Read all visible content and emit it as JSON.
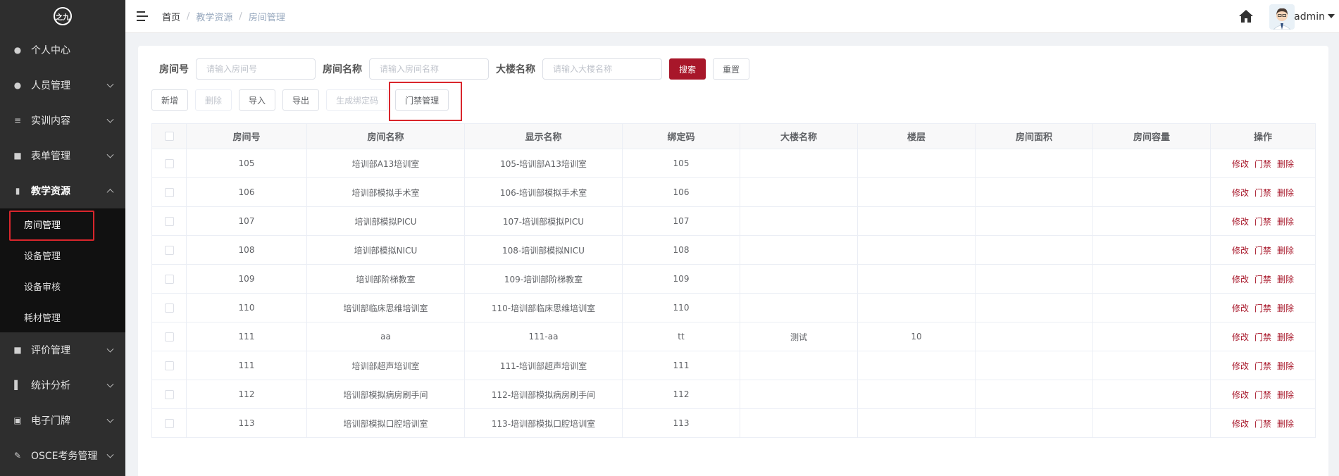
{
  "sidebar": {
    "logo": "之九",
    "items": [
      {
        "label": "个人中心",
        "icon": "user-icon",
        "expandable": false
      },
      {
        "label": "人员管理",
        "icon": "users-icon",
        "expandable": true
      },
      {
        "label": "实训内容",
        "icon": "list-icon",
        "expandable": true
      },
      {
        "label": "表单管理",
        "icon": "form-icon",
        "expandable": true
      },
      {
        "label": "教学资源",
        "icon": "book-icon",
        "expandable": true,
        "expanded": true,
        "children": [
          {
            "label": "房间管理",
            "current": true
          },
          {
            "label": "设备管理"
          },
          {
            "label": "设备审核"
          },
          {
            "label": "耗材管理"
          }
        ]
      },
      {
        "label": "评价管理",
        "icon": "rating-icon",
        "expandable": true
      },
      {
        "label": "统计分析",
        "icon": "bar-chart-icon",
        "expandable": true
      },
      {
        "label": "电子门牌",
        "icon": "monitor-icon",
        "expandable": true
      },
      {
        "label": "OSCE考务管理",
        "icon": "edit-icon",
        "expandable": true
      }
    ]
  },
  "header": {
    "breadcrumb": [
      "首页",
      "教学资源",
      "房间管理"
    ],
    "user": "admin"
  },
  "filters": {
    "room_no": {
      "label": "房间号",
      "placeholder": "请输入房间号"
    },
    "room_name": {
      "label": "房间名称",
      "placeholder": "请输入房间名称"
    },
    "building": {
      "label": "大楼名称",
      "placeholder": "请输入大楼名称"
    },
    "search_label": "搜索",
    "reset_label": "重置"
  },
  "toolbar": {
    "add": "新增",
    "delete": "删除",
    "import": "导入",
    "export": "导出",
    "gen_code": "生成绑定码",
    "access": "门禁管理"
  },
  "table": {
    "columns": [
      "房间号",
      "房间名称",
      "显示名称",
      "绑定码",
      "大楼名称",
      "楼层",
      "房间面积",
      "房间容量",
      "操作"
    ],
    "actions": [
      "修改",
      "门禁",
      "删除"
    ],
    "rows": [
      {
        "room_no": "105",
        "room_name": "培训部A13培训室",
        "display": "105-培训部A13培训室",
        "code": "105",
        "building": "",
        "floor": "",
        "area": "",
        "capacity": ""
      },
      {
        "room_no": "106",
        "room_name": "培训部模拟手术室",
        "display": "106-培训部模拟手术室",
        "code": "106",
        "building": "",
        "floor": "",
        "area": "",
        "capacity": ""
      },
      {
        "room_no": "107",
        "room_name": "培训部模拟PICU",
        "display": "107-培训部模拟PICU",
        "code": "107",
        "building": "",
        "floor": "",
        "area": "",
        "capacity": ""
      },
      {
        "room_no": "108",
        "room_name": "培训部模拟NICU",
        "display": "108-培训部模拟NICU",
        "code": "108",
        "building": "",
        "floor": "",
        "area": "",
        "capacity": ""
      },
      {
        "room_no": "109",
        "room_name": "培训部阶梯教室",
        "display": "109-培训部阶梯教室",
        "code": "109",
        "building": "",
        "floor": "",
        "area": "",
        "capacity": ""
      },
      {
        "room_no": "110",
        "room_name": "培训部临床思维培训室",
        "display": "110-培训部临床思维培训室",
        "code": "110",
        "building": "",
        "floor": "",
        "area": "",
        "capacity": ""
      },
      {
        "room_no": "111",
        "room_name": "aa",
        "display": "111-aa",
        "code": "tt",
        "building": "测试",
        "floor": "10",
        "area": "",
        "capacity": ""
      },
      {
        "room_no": "111",
        "room_name": "培训部超声培训室",
        "display": "111-培训部超声培训室",
        "code": "111",
        "building": "",
        "floor": "",
        "area": "",
        "capacity": ""
      },
      {
        "room_no": "112",
        "room_name": "培训部模拟病房刷手间",
        "display": "112-培训部模拟病房刷手间",
        "code": "112",
        "building": "",
        "floor": "",
        "area": "",
        "capacity": ""
      },
      {
        "room_no": "113",
        "room_name": "培训部模拟口腔培训室",
        "display": "113-培训部模拟口腔培训室",
        "code": "113",
        "building": "",
        "floor": "",
        "area": "",
        "capacity": ""
      }
    ]
  },
  "colors": {
    "sidebar_bg": "#2e2e2e",
    "primary": "#a8172a",
    "highlight": "#d9262c"
  }
}
